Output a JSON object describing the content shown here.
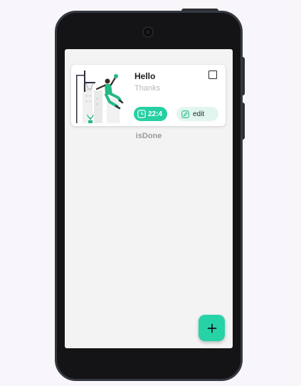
{
  "task_card": {
    "title": "Hello",
    "subtitle": "Thanks",
    "time": "22:4",
    "edit_label": "edit",
    "image_icon": "basketball-player-illustration",
    "checked": false
  },
  "status_label": "isDone",
  "fab": {
    "icon": "plus-icon"
  },
  "colors": {
    "accent": "#25d0a3",
    "edit_chip_bg": "#e2f6ef",
    "screen_bg": "#f3f3f3",
    "phone_frame": "#141416"
  }
}
